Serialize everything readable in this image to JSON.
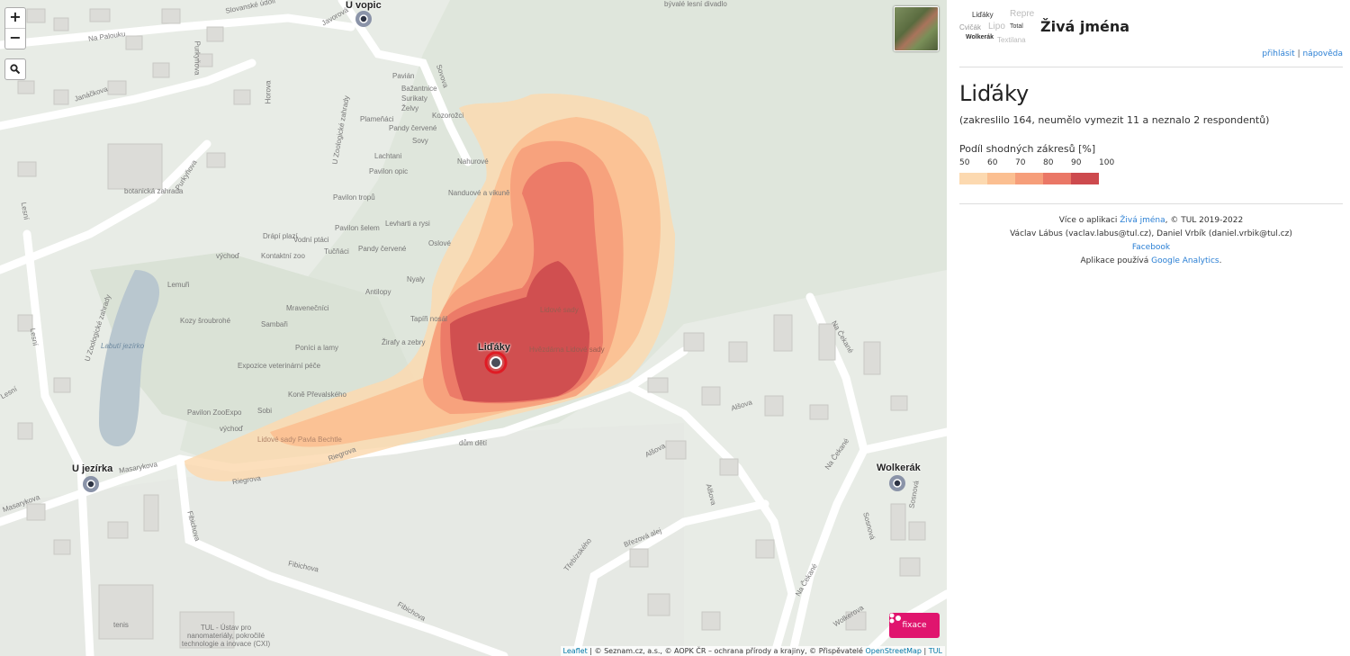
{
  "map": {
    "zoom_in": "+",
    "zoom_out": "−",
    "fix_label": "fixace",
    "attribution": {
      "leaflet": "Leaflet",
      "text": " | © Seznam.cz, a.s., © AOPK ČR – ochrana přírody a krajiny, © Přispěvatelé ",
      "osm": "OpenStreetMap",
      "sep": " | ",
      "tul": "TUL"
    },
    "places": {
      "main": "Liďáky",
      "vopic": "U vopic",
      "jezirka": "U jezírka",
      "wolkerak": "Wolkerák"
    },
    "streets": [
      "Slovanské údolí",
      "Na Palouku",
      "Javorová",
      "Purkyňova",
      "Janáčkova",
      "Horova",
      "U Zoologické zahrady",
      "Sovova",
      "Purkyňova",
      "Lesní",
      "U Zoologické zahrady",
      "Lesní",
      "Masarykova",
      "Masarykova",
      "Riegrova",
      "Riegrova",
      "Fibichova",
      "Fibichova",
      "Fibichova",
      "Alšova",
      "Alšova",
      "Alšova",
      "Třebízského",
      "Březová alej",
      "Na Čekané",
      "Na Čekané",
      "Na Čekané",
      "Sosnová",
      "Sosnová",
      "Wolkerova",
      "Lesní"
    ],
    "pois": [
      "Pavián",
      "Bažantnice",
      "Surikaty",
      "Želvy",
      "Plameňáci",
      "Pandy červené",
      "Sovy",
      "Kozorožci",
      "Lachtani",
      "Pavilon opic",
      "Nahurové",
      "Nanduové a vikuně",
      "Pavilon tropů",
      "Drápí plazí",
      "Vodní ptáci",
      "Kontaktní zoo",
      "Pavilon šelem",
      "Levharti a rysi",
      "Tučňáci",
      "Pandy červené",
      "Oslové",
      "Antilopy",
      "Nyaly",
      "Mravenečníci",
      "Kozy šroubrohé",
      "Sambaři",
      "Tapíři nosál",
      "Poníci a lamy",
      "Žirafy a zebry",
      "Expozice veterinární péče",
      "Koně Převalského",
      "Pavilon ZooExpo",
      "Sobi",
      "výchoď",
      "Lemuři",
      "Labutí jezírko",
      "botanická zahrada",
      "Lidové sady",
      "Lidové sady Pavla Bechtle",
      "Hvězdárna Lidové sady",
      "dům dětí",
      "tenis",
      "TUL - Ústav pro nanomateriály, pokročilé technologie a inovace (CXI)",
      "bývalé lesní divadlo",
      "výchoď"
    ]
  },
  "panel": {
    "logo_words": [
      "Liďáky",
      "Repre",
      "Cvičák",
      "Lipo",
      "Total",
      "Wolkerák",
      "Textilana"
    ],
    "app_title": "Živá jména",
    "login": "přihlásit",
    "sep": " | ",
    "help": "nápověda",
    "name": "Liďáky",
    "stats": "(zakreslilo 164, neumělo vymezit 11 a neznalo 2 respondentů)",
    "legend_title": "Podíl shodných zákresů [%]",
    "legend_ticks": [
      "50",
      "60",
      "70",
      "80",
      "90",
      "100"
    ],
    "legend_colors": [
      "#fcd9b0",
      "#fbbf91",
      "#f69e7a",
      "#ea7766",
      "#cd4a4e"
    ],
    "footer": {
      "line1_prefix": "Více o aplikaci ",
      "line1_link": "Živá jména",
      "line1_suffix": ", © TUL 2019-2022",
      "line2": "Václav Lábus (vaclav.labus@tul.cz), Daniel Vrbík (daniel.vrbik@tul.cz)",
      "facebook": "Facebook",
      "line4_prefix": "Aplikace používá ",
      "line4_link": "Google Analytics",
      "line4_suffix": "."
    }
  }
}
